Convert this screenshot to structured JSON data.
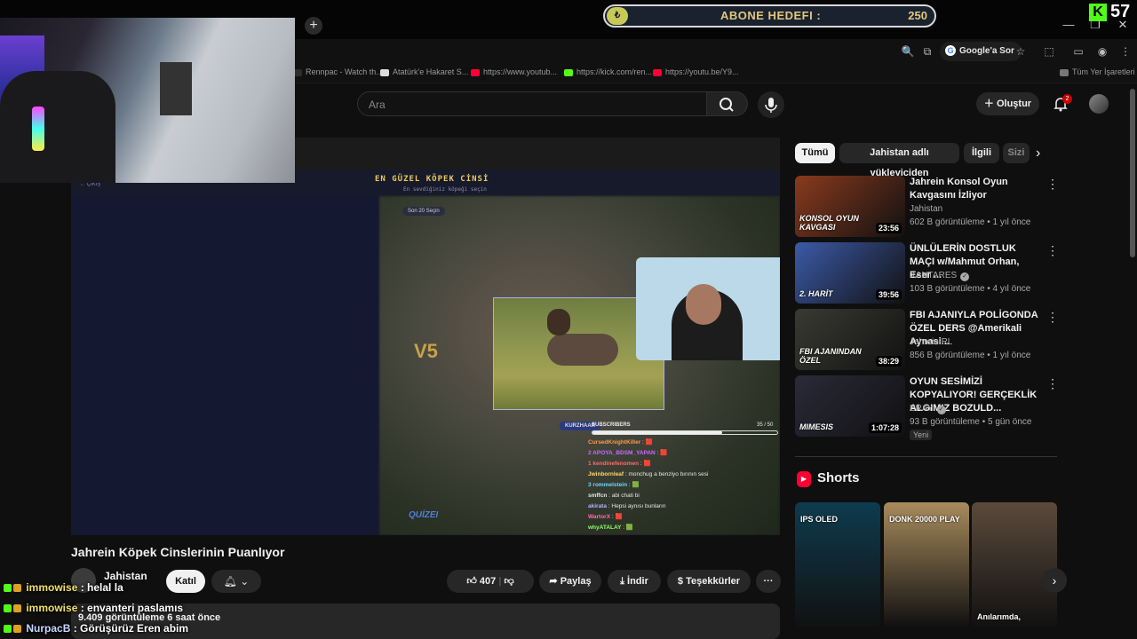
{
  "stream": {
    "goal_label": "ABONE HEDEFI :",
    "goal_value": "250",
    "goal_coin": "₺",
    "viewer_count": "57",
    "kick_logo": "K"
  },
  "browser": {
    "new_tab_symbol": "+",
    "google_sor": "Google'a Sor",
    "bookmarks": [
      {
        "label": "Rennpac - Watch th...",
        "color": "#2d2d2d"
      },
      {
        "label": "Atatürk'e Hakaret S...",
        "color": "#dddddd"
      },
      {
        "label": "https://www.youtub...",
        "color": "#ff0033"
      },
      {
        "label": "https://kick.com/ren...",
        "color": "#53fc18"
      },
      {
        "label": "https://youtu.be/Y9...",
        "color": "#ff0033"
      }
    ],
    "all_bookmarks": "Tüm Yer İşaretleri"
  },
  "youtube": {
    "search_placeholder": "Ara",
    "create_label": "Oluştur",
    "notif_count": "2",
    "avatar_text": "99"
  },
  "player_content": {
    "back_label": "← ÇIKIŞ",
    "title": "EN GÜZEL KÖPEK CİNSİ",
    "subtitle": "En sevdiğiniz köpeği seçin",
    "pill": "Son 20 Seçin",
    "kurzh": "KURZHAAR",
    "subscribers_label": "SUBSCRIBERS",
    "subscribers_count": "35 / 50",
    "subscribers_progress": 0.7,
    "logo_v5": "V5",
    "quiz_logo": "QUİZEI",
    "chat": [
      {
        "user": "CursedKnightKiller",
        "msg": ": 🟥",
        "color": "#ff9a4a"
      },
      {
        "user": "2  APOYA_BDSM_YAPAN",
        "msg": ": 🟥",
        "color": "#c86bff"
      },
      {
        "user": "1  kendinefenomen",
        "msg": ": 🟥",
        "color": "#ff6b6b"
      },
      {
        "user": "Jwinbornleaf",
        "msg": ": monchug a benziyo bırının sesi",
        "color": "#ffd86b"
      },
      {
        "user": "3  rommelstein",
        "msg": ": 🟩",
        "color": "#6bd7ff"
      },
      {
        "user": "smffcn",
        "msg": ": abi chati bi",
        "color": "#e8e8e8"
      },
      {
        "user": "akirata",
        "msg": ": Hepsi aynısı bunların",
        "color": "#b4b4ff"
      },
      {
        "user": "WartorX",
        "msg": ": 🟥",
        "color": "#ff6bb4"
      },
      {
        "user": "whyATALAY",
        "msg": ": 🟩",
        "color": "#8cff6b"
      }
    ]
  },
  "video": {
    "title": "Jahrein Köpek Cinslerinin Puanlıyor",
    "channel": "Jahistan",
    "join_label": "Katıl",
    "likes": "407",
    "share_label": "Paylaş",
    "download_label": "İndir",
    "thanks_label": "Teşekkürler",
    "more_label": "···",
    "meta": "9.409 görüntüleme  6 saat önce"
  },
  "kick_chat": [
    {
      "user": "immowise",
      "msg": ": helal la"
    },
    {
      "user": "immowise",
      "msg": ": envanteri paslamıs"
    },
    {
      "user": "NurpacB",
      "msg": ": Görüşürüz Eren abim"
    }
  ],
  "sidebar": {
    "chips": [
      "Tümü",
      "Jahistan adlı yükleyiciden",
      "İlgili",
      "Sizi"
    ],
    "related": [
      {
        "title": "Jahrein Konsol Oyun Kavgasını İzliyor",
        "channel": "Jahistan",
        "meta": "602 B görüntüleme • 1 yıl önce",
        "duration": "23:56",
        "thumb_text": "KONSOL OYUN KAVGASI",
        "color": "#8a3a1e",
        "verified": false
      },
      {
        "title": "ÜNLÜLERİN DOSTLUK MAÇI w/Mahmut Orhan, Eser ...",
        "channel": "XANTARES",
        "meta": "103 B görüntüleme • 4 yıl önce",
        "duration": "39:56",
        "thumb_text": "2. HARİT",
        "color": "#3c5aa8",
        "verified": true
      },
      {
        "title": "FBI AJANIYLA POLİGONDA ÖZEL DERS @Amerikali Aynasi...",
        "channel": "JahreinIRL",
        "meta": "856 B görüntüleme • 1 yıl önce",
        "duration": "38:29",
        "thumb_text": "FBI AJANINDAN ÖZEL",
        "color": "#3a3a34",
        "verified": false
      },
      {
        "title": "OYUN SESİMİZİ KOPYALIYOR! GERÇEKLİK ALGIMIZ BOZULD...",
        "channel": "ERAY",
        "meta": "93 B görüntüleme • 5 gün önce",
        "duration": "1:07:28",
        "thumb_text": "MIMESIS",
        "color": "#2a2a3a",
        "verified": true
      }
    ],
    "new_badge": "Yeni",
    "shorts_title": "Shorts",
    "shorts": [
      {
        "text": "IPS   OLED",
        "color": "#0e3b4f"
      },
      {
        "text": "DONK 20000 PLAY",
        "color": "#a88b5c"
      },
      {
        "text": "Anılarımda,",
        "color": "#5b4a3c"
      }
    ]
  }
}
